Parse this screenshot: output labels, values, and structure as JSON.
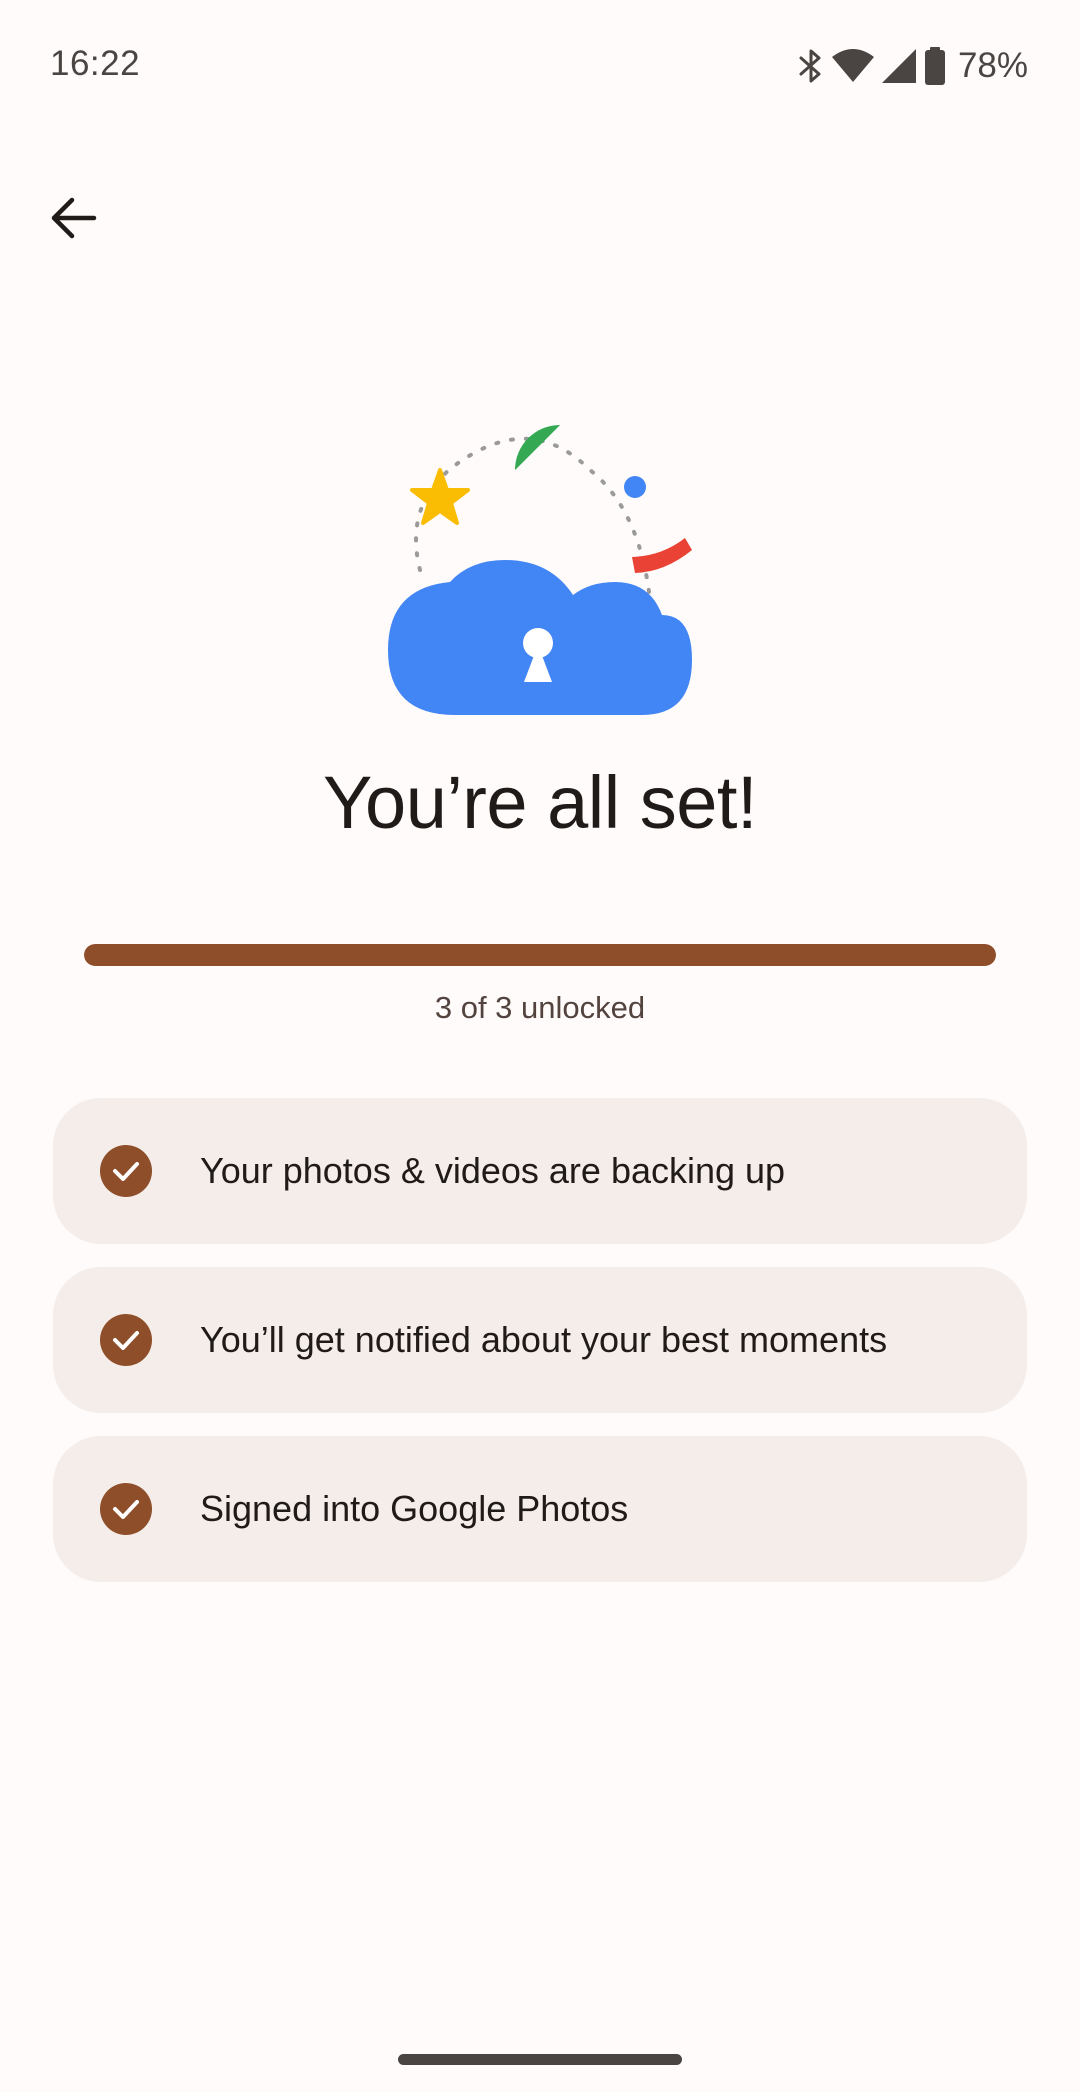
{
  "status_bar": {
    "time": "16:22",
    "battery": "78%",
    "icons": [
      "bluetooth-icon",
      "wifi-icon",
      "cellular-signal-icon",
      "battery-icon"
    ]
  },
  "header": {
    "back_icon": "arrow-back-icon"
  },
  "illustration": {
    "name": "cloud-lock-illustration",
    "colors": {
      "cloud": "#4285F4",
      "star": "#FBBC04",
      "green_arc": "#34A853",
      "blue_dot": "#4285F4",
      "red_arc": "#EA4335"
    }
  },
  "main": {
    "title": "You’re all set!",
    "progress": {
      "value": 1.0,
      "label": "3 of 3 unlocked"
    },
    "items": [
      {
        "label": "Your photos & videos are backing up",
        "icon": "check-circle-icon"
      },
      {
        "label": "You’ll get notified about your best moments",
        "icon": "check-circle-icon"
      },
      {
        "label": "Signed into Google Photos",
        "icon": "check-circle-icon"
      }
    ]
  },
  "colors": {
    "accent": "#8E4E29",
    "card_background": "#F4EDEA",
    "page_background": "#FFFBFA"
  }
}
